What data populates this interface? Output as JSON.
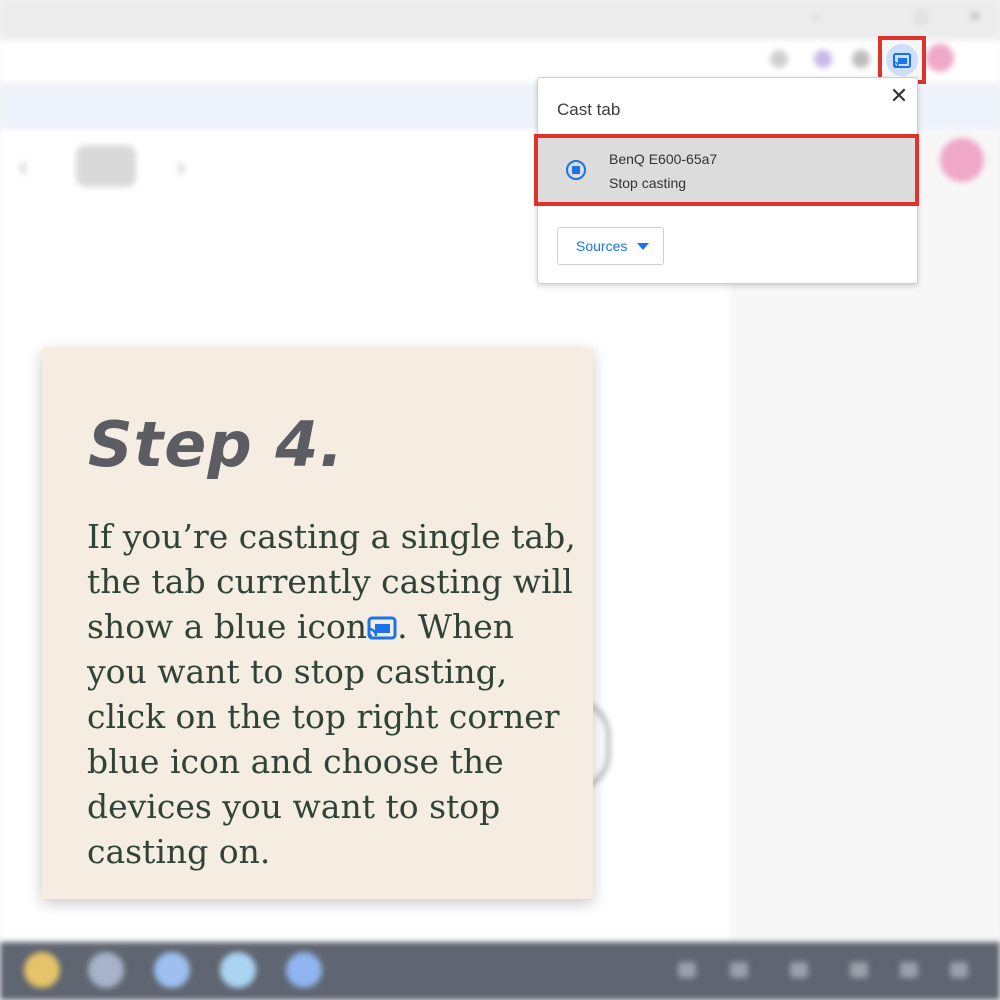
{
  "popup": {
    "title": "Cast tab",
    "close_glyph": "✕",
    "device": {
      "name": "BenQ E600-65a7",
      "status": "Stop casting",
      "icon": "casting-stop-icon"
    },
    "sources_label": "Sources"
  },
  "toolbar": {
    "cast_icon": "cast-icon",
    "cast_icon_color": "#1a73e8"
  },
  "card": {
    "title": "Step 4.",
    "body_part1": "If you’re casting a single tab, the tab currently casting will show a blue icon",
    "body_part2": ". When you want to stop casting, click on the top right corner blue icon and choose the devices you want to stop casting on."
  },
  "colors": {
    "highlight": "#e0312b",
    "accent": "#1a73e8",
    "card_bg": "#f5ede2"
  }
}
